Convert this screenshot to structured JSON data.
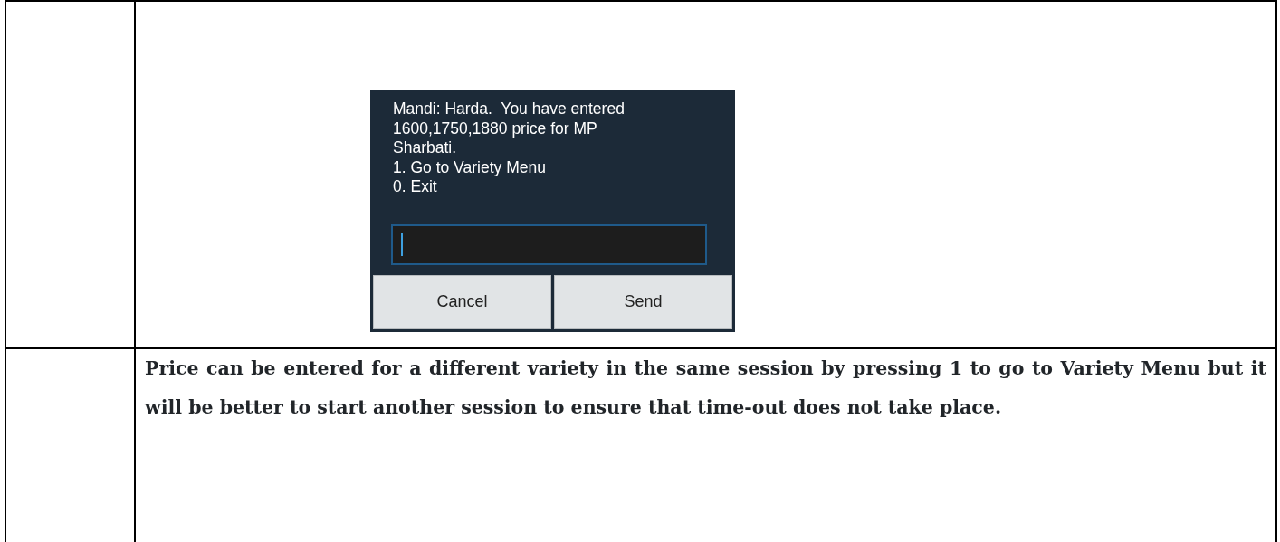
{
  "dialog": {
    "message_lines": [
      "Mandi: Harda.  You have entered",
      "1600,1750,1880 price for MP",
      "Sharbati.",
      "1. Go to Variety Menu",
      "0. Exit"
    ],
    "buttons": [
      "Cancel",
      "Send"
    ]
  },
  "note": "Price can be entered for a different variety in the same session by pressing 1 to go to Variety Menu but it will be better to start another session to ensure that time-out does not take place."
}
